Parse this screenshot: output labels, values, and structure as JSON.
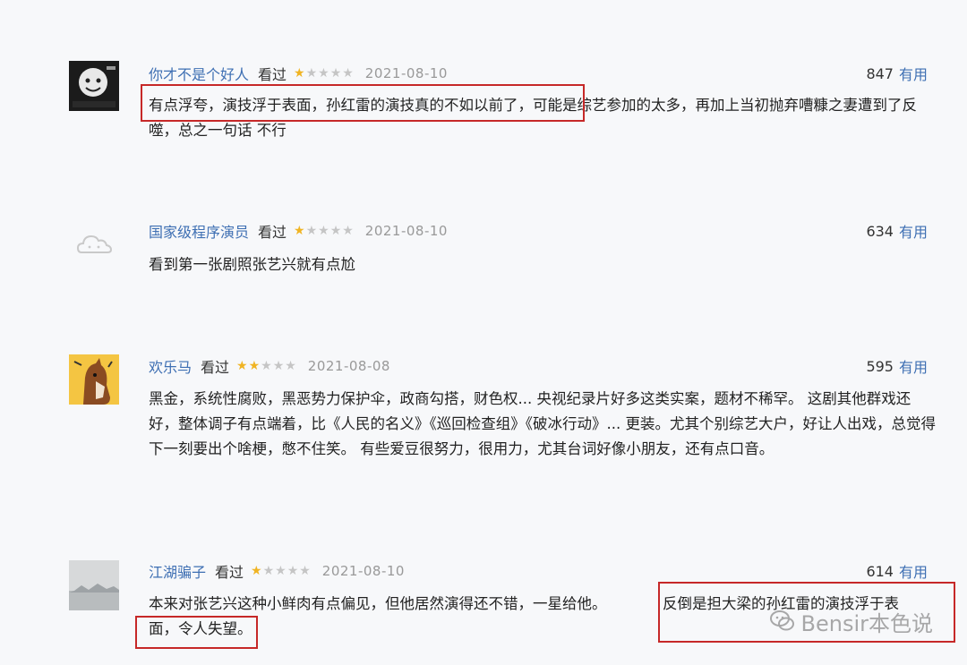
{
  "reviews": [
    {
      "username": "你才不是个好人",
      "status": "看过",
      "rating": 1,
      "max_rating": 5,
      "date": "2021-08-10",
      "useful_count": "847",
      "useful_label": "有用",
      "content_parts": [
        "有点浮夸，演技浮于表面，孙红雷的演技真的不如以前了，",
        "可能是综艺参加的太多，再加上当初抛弃嘈糠之妻遭到了反噬，总之一句话 不行"
      ]
    },
    {
      "username": "国家级程序演员",
      "status": "看过",
      "rating": 1,
      "max_rating": 5,
      "date": "2021-08-10",
      "useful_count": "634",
      "useful_label": "有用",
      "content": "看到第一张剧照张艺兴就有点尬"
    },
    {
      "username": "欢乐马",
      "status": "看过",
      "rating": 2,
      "max_rating": 5,
      "date": "2021-08-08",
      "useful_count": "595",
      "useful_label": "有用",
      "content": "黑金，系统性腐败，黑恶势力保护伞，政商勾搭，财色权... 央视纪录片好多这类实案，题材不稀罕。 这剧其他群戏还好，整体调子有点端着，比《人民的名义》《巡回检查组》《破冰行动》... 更装。尤其个别综艺大户，好让人出戏，总觉得下一刻要出个啥梗，憋不住笑。 有些爱豆很努力，很用力，尤其台词好像小朋友，还有点口音。"
    },
    {
      "username": "江湖骗子",
      "status": "看过",
      "rating": 1,
      "max_rating": 5,
      "date": "2021-08-10",
      "useful_count": "614",
      "useful_label": "有用",
      "content_parts": [
        "本来对张艺兴这种小鲜肉有点偏见，但他居然演得还不错，一星给他。",
        "反倒是担大梁的孙红雷的演技浮于表",
        "面，令人失望。"
      ]
    }
  ],
  "watermark": {
    "text": "Bensir本色说",
    "icon": "wechat-icon"
  },
  "colors": {
    "highlight": "#c62828",
    "link": "#3e6fb3",
    "star": "#f0b423"
  }
}
